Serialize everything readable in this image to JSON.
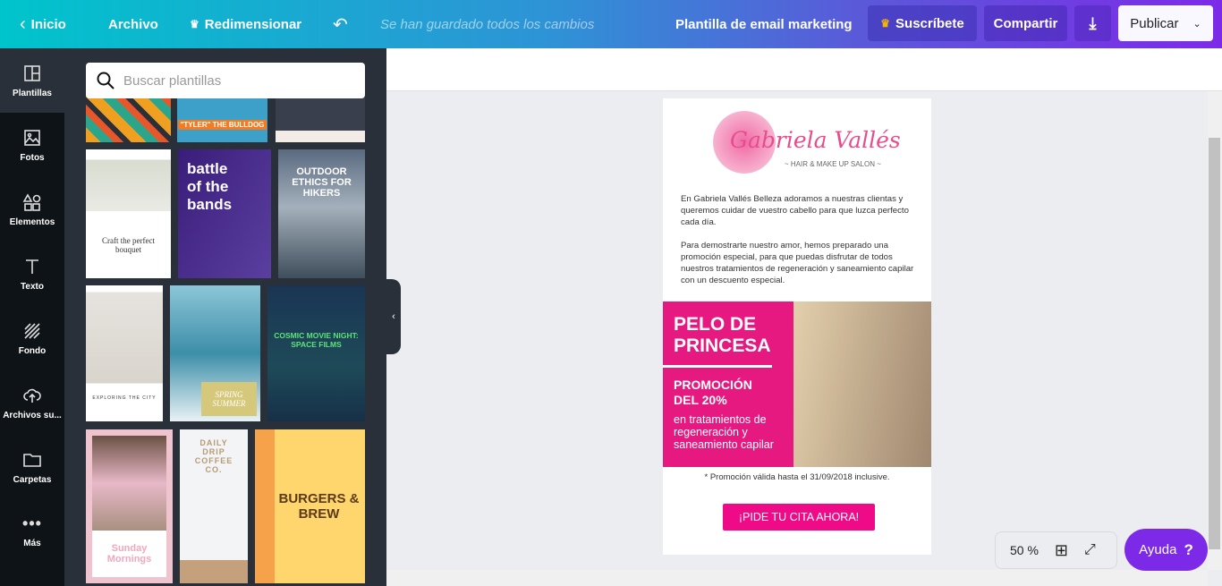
{
  "header": {
    "home": "Inicio",
    "file": "Archivo",
    "resize": "Redimensionar",
    "saved_status": "Se han guardado todos los cambios",
    "doc_title": "Plantilla de email marketing",
    "subscribe": "Suscríbete",
    "share": "Compartir",
    "publish": "Publicar",
    "accent": "#7d2ae8"
  },
  "sidebar": {
    "items": [
      {
        "label": "Plantillas",
        "icon": "templates-icon"
      },
      {
        "label": "Fotos",
        "icon": "photos-icon"
      },
      {
        "label": "Elementos",
        "icon": "elements-icon"
      },
      {
        "label": "Texto",
        "icon": "text-icon"
      },
      {
        "label": "Fondo",
        "icon": "background-icon"
      },
      {
        "label": "Archivos su...",
        "icon": "upload-icon"
      },
      {
        "label": "Carpetas",
        "icon": "folder-icon"
      },
      {
        "label": "Más",
        "icon": "more-icon"
      }
    ]
  },
  "panel": {
    "search_placeholder": "Buscar plantillas",
    "templates": [
      {
        "title": ""
      },
      {
        "title": "\"TYLER\" THE BULLDOG"
      },
      {
        "title": ""
      },
      {
        "title": "Craft the perfect bouquet"
      },
      {
        "title": "battle of the bands"
      },
      {
        "title": "OUTDOOR ETHICS FOR HIKERS"
      },
      {
        "title": "EXPLORING THE CITY"
      },
      {
        "title": "SPRING SUMMER"
      },
      {
        "title": "COSMIC MOVIE NIGHT: SPACE FILMS"
      },
      {
        "title": "Sunday Mornings"
      },
      {
        "title": "DAILY DRIP COFFEE CO."
      },
      {
        "title": "BURGERS & BREW"
      }
    ]
  },
  "email": {
    "brand": "Gabriela Vallés",
    "brand_tagline": "~ HAIR & MAKE UP SALON ~",
    "para1": "En Gabriela Vallés Belleza adoramos a nuestras clientas y queremos cuidar de vuestro cabello para que luzca perfecto cada día.",
    "para2": "Para demostrarte nuestro amor, hemos preparado una promoción especial, para que puedas disfrutar de todos nuestros tratamientos de regeneración y saneamiento capilar con un descuento especial.",
    "promo_title": "PELO DE PRINCESA",
    "promo_discount": "PROMOCIÓN DEL 20%",
    "promo_desc": "en tratamientos de regeneración y saneamiento capilar",
    "disclaimer": "* Promoción válida hasta el 31/09/2018 inclusive.",
    "cta": "¡PIDE TU CITA AHORA!",
    "pink": "#e5197f"
  },
  "footer": {
    "zoom": "50 %",
    "help": "Ayuda"
  }
}
